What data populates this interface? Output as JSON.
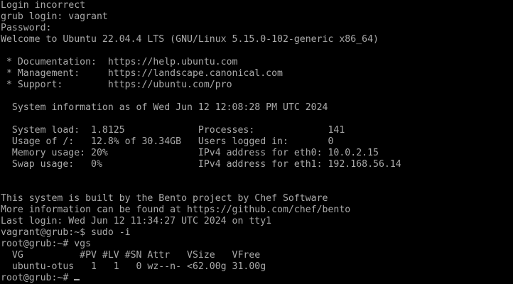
{
  "terminal": {
    "foreground": "#aaaaaa",
    "background": "#000000",
    "lines": [
      "Login incorrect",
      "grub login: vagrant",
      "Password:",
      "Welcome to Ubuntu 22.04.4 LTS (GNU/Linux 5.15.0-102-generic x86_64)",
      "",
      " * Documentation:  https://help.ubuntu.com",
      " * Management:     https://landscape.canonical.com",
      " * Support:        https://ubuntu.com/pro",
      "",
      "  System information as of Wed Jun 12 12:08:28 PM UTC 2024",
      "",
      "  System load:  1.8125             Processes:             141",
      "  Usage of /:   12.8% of 30.34GB   Users logged in:       0",
      "  Memory usage: 20%                IPv4 address for eth0: 10.0.2.15",
      "  Swap usage:   0%                 IPv4 address for eth1: 192.168.56.14",
      "",
      "",
      "This system is built by the Bento project by Chef Software",
      "More information can be found at https://github.com/chef/bento",
      "Last login: Wed Jun 12 11:34:27 UTC 2024 on tty1",
      "vagrant@grub:~$ sudo -i",
      "root@grub:~# vgs",
      "  VG          #PV #LV #SN Attr   VSize   VFree",
      "  ubuntu-otus   1   1   0 wz--n- <62.00g 31.00g"
    ],
    "prompt": "root@grub:~# "
  }
}
